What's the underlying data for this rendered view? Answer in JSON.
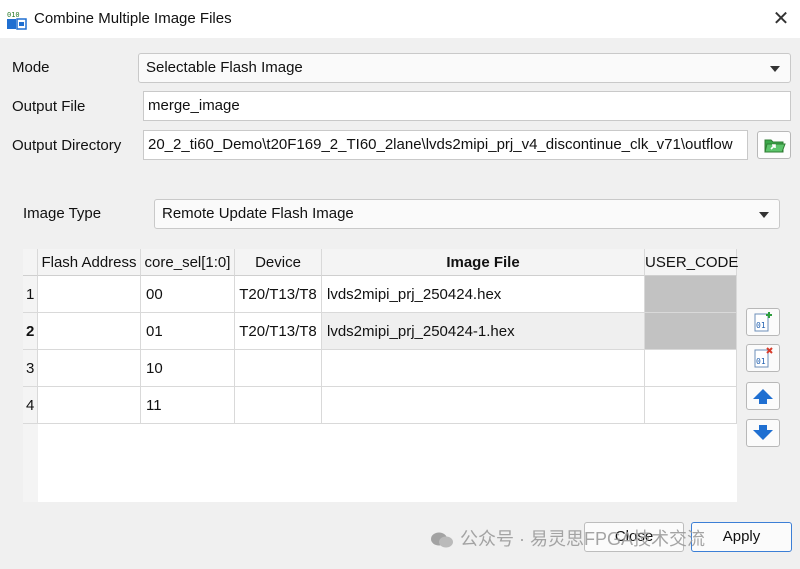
{
  "window": {
    "title": "Combine Multiple Image Files",
    "app_icon_text": "010"
  },
  "form": {
    "mode_label": "Mode",
    "mode_value": "Selectable Flash Image",
    "output_file_label": "Output File",
    "output_file_value": "merge_image",
    "output_dir_label": "Output Directory",
    "output_dir_value": "20_2_ti60_Demo\\t20F169_2_TI60_2lane\\lvds2mipi_prj_v4_discontinue_clk_v71\\outflow",
    "image_type_label": "Image Type",
    "image_type_value": "Remote Update Flash Image"
  },
  "table": {
    "headers": [
      "Flash Address",
      "core_sel[1:0]",
      "Device",
      "Image File",
      "USER_CODE"
    ],
    "rows": [
      {
        "num": "1",
        "flash_address": "",
        "core_sel": "00",
        "device": "T20/T13/T8",
        "image_file": "lvds2mipi_prj_250424.hex",
        "user_code": ""
      },
      {
        "num": "2",
        "flash_address": "",
        "core_sel": "01",
        "device": "T20/T13/T8",
        "image_file": "lvds2mipi_prj_250424-1.hex",
        "user_code": ""
      },
      {
        "num": "3",
        "flash_address": "",
        "core_sel": "10",
        "device": "",
        "image_file": "",
        "user_code": ""
      },
      {
        "num": "4",
        "flash_address": "",
        "core_sel": "11",
        "device": "",
        "image_file": "",
        "user_code": ""
      }
    ]
  },
  "side_buttons": {
    "add_icon_text": "01",
    "remove_icon_text": "01"
  },
  "footer": {
    "close_label": "Close",
    "apply_label": "Apply",
    "watermark": "公众号 · 易灵思FPGA技术交流"
  },
  "colors": {
    "accent": "#3c7fd6",
    "arrow_blue": "#1f6fd1",
    "folder_green": "#2e9e3e",
    "user_code_gray": "#c2c2c2"
  }
}
